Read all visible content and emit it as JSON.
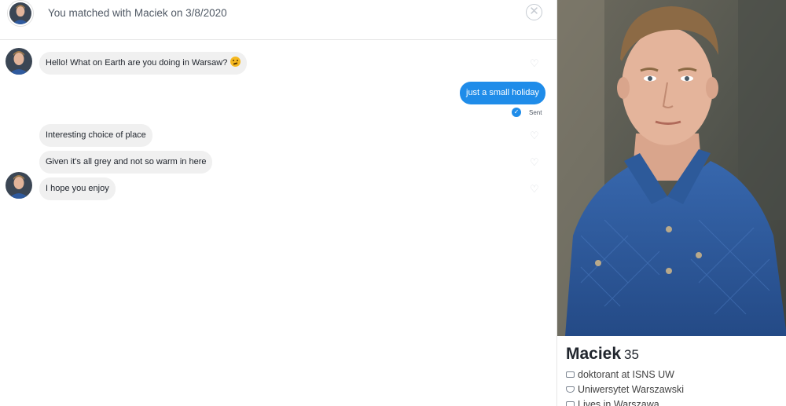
{
  "header": {
    "match_text": "You matched with Maciek on 3/8/2020",
    "close_icon": "close-icon"
  },
  "messages": [
    {
      "direction": "in",
      "text": "Hello! What on Earth are you doing in Warsaw?",
      "emoji": "thinking-face",
      "show_avatar": true
    },
    {
      "direction": "out",
      "text": "just a small holiday",
      "status": "Sent"
    },
    {
      "direction": "in",
      "text": "Interesting choice of place",
      "show_avatar": false
    },
    {
      "direction": "in",
      "text": "Given it's all grey and not so warm in here",
      "show_avatar": false
    },
    {
      "direction": "in",
      "text": "I hope you enjoy",
      "show_avatar": true
    }
  ],
  "profile": {
    "name": "Maciek",
    "age": "35",
    "job": "doktorant at ISNS UW",
    "school": "Uniwersytet Warszawski",
    "location": "Lives in Warszawa"
  },
  "colors": {
    "sent_bubble": "#1f8ce9",
    "received_bubble": "#f0f0f0",
    "jacket": "#2f5a9e"
  }
}
